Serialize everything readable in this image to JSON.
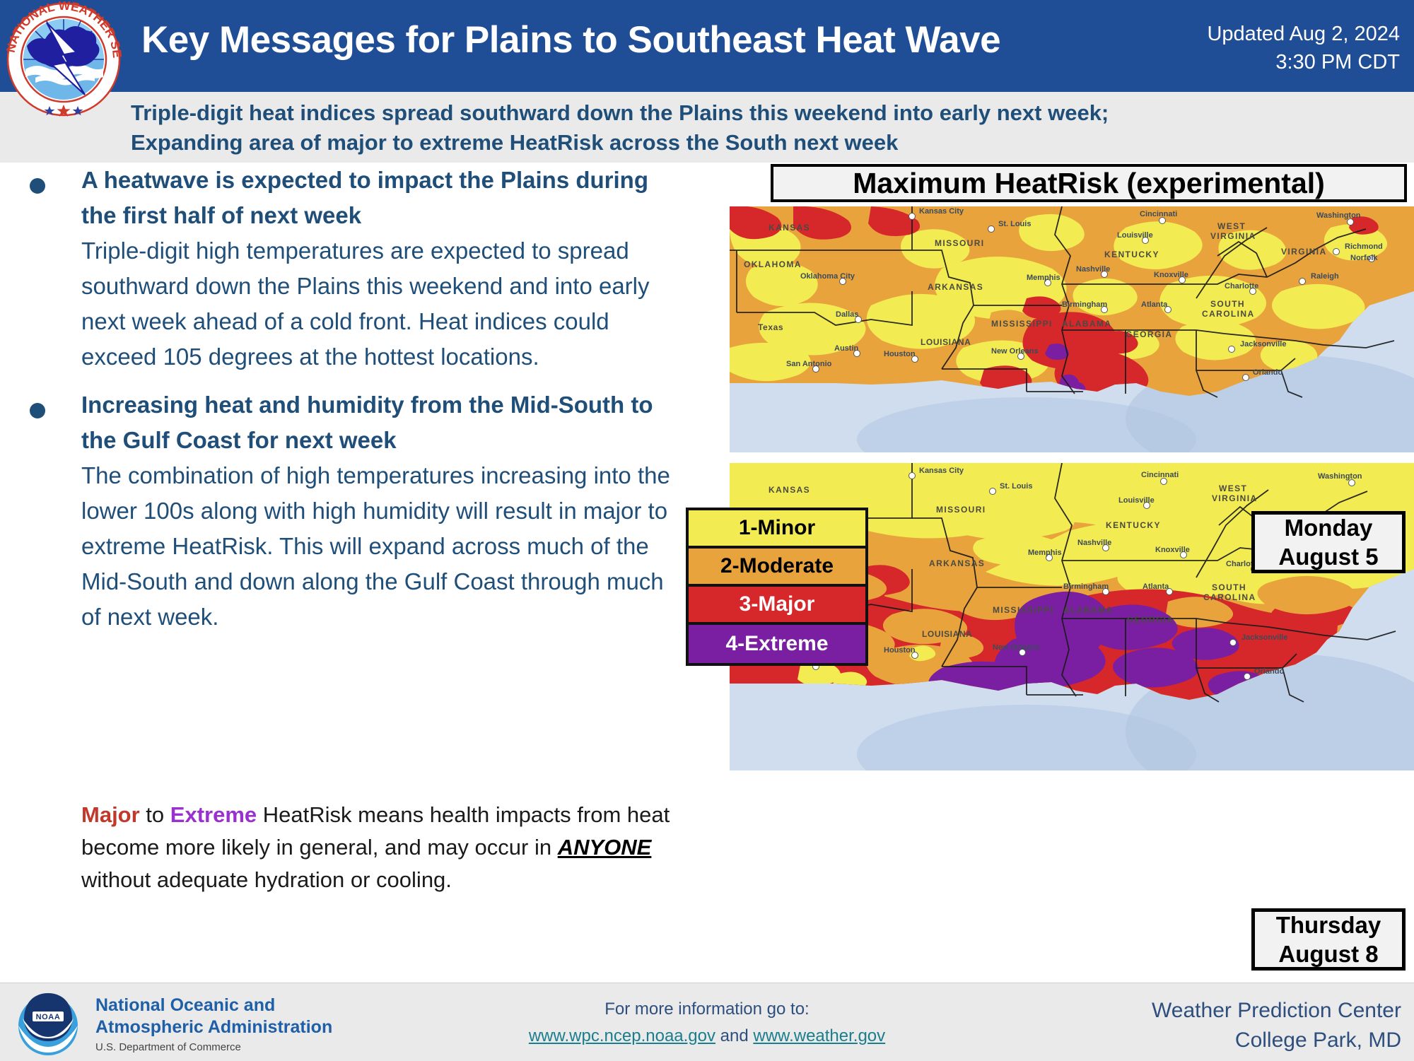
{
  "header": {
    "title": "Key Messages for Plains to Southeast Heat Wave",
    "updated_line1": "Updated Aug 2, 2024",
    "updated_line2": "3:30 PM CDT",
    "logo_alt": "nws-logo",
    "background_color": "#1F4E96"
  },
  "subtitle": {
    "line1": "Triple-digit heat indices spread southward down the Plains this weekend into early next week;",
    "line2": "Expanding area of major to extreme HeatRisk across the South next week",
    "text_color": "#1F4E79",
    "background_color": "#EAEAEA"
  },
  "bullets": [
    {
      "heading": "A heatwave is expected to impact the Plains during the first half of next week",
      "body": "Triple-digit high temperatures are expected to spread southward down the Plains this weekend and into early next week ahead of a cold front.  Heat indices could exceed 105 degrees at the hottest locations."
    },
    {
      "heading": "Increasing heat and humidity from the Mid-South to the Gulf Coast for next week",
      "body": "The combination of high temperatures increasing into the lower 100s along with high humidity will result in major to extreme HeatRisk.  This will expand across much of the Mid-South and down along the Gulf Coast through much of next week."
    }
  ],
  "closing": {
    "word_major": "Major",
    "mid1": " to ",
    "word_extreme": "Extreme",
    "mid2": " HeatRisk means health impacts from heat become more likely in general, and may occur in ",
    "word_anyone": "ANYONE",
    "tail": " without adequate hydration or cooling.",
    "major_color": "#C0392B",
    "extreme_color": "#9B30D0"
  },
  "maps": {
    "title": "Maximum HeatRisk (experimental)",
    "panels": [
      {
        "id": "map-monday",
        "day_line1": "Monday",
        "day_line2": "August 5"
      },
      {
        "id": "map-thursday",
        "day_line1": "Thursday",
        "day_line2": "August 8"
      }
    ],
    "legend": [
      {
        "label": "1-Minor",
        "color": "#F3EB52",
        "text_color": "#000000"
      },
      {
        "label": "2-Moderate",
        "color": "#E8A33D",
        "text_color": "#000000"
      },
      {
        "label": "3-Major",
        "color": "#D6272B",
        "text_color": "#FFFFFF"
      },
      {
        "label": "4-Extreme",
        "color": "#7B1FA2",
        "text_color": "#FFFFFF"
      }
    ],
    "state_labels": [
      "KANSAS",
      "MISSOURI",
      "OKLAHOMA",
      "ARKANSAS",
      "Texas",
      "LOUISIANA",
      "MISSISSIPPI",
      "ALABAMA",
      "GEORGIA",
      "KENTUCKY",
      "WEST VIRGINIA",
      "VIRGINIA",
      "SOUTH CAROLINA"
    ],
    "city_labels": [
      "Kansas City",
      "St. Louis",
      "Cincinnati",
      "Washington",
      "Louisville",
      "Richmond",
      "Norfolk",
      "Nashville",
      "Knoxville",
      "Raleigh",
      "Oklahoma City",
      "Memphis",
      "Charlotte",
      "Dallas",
      "Birmingham",
      "Atlanta",
      "Austin",
      "Houston",
      "San Antonio",
      "New Orleans",
      "Jacksonville",
      "Orlando"
    ],
    "ocean_color": "#BFD3E6"
  },
  "footer": {
    "noaa_line1": "National Oceanic and",
    "noaa_line2": "Atmospheric Administration",
    "noaa_sub": "U.S. Department of Commerce",
    "info_label": "For more information go to:",
    "link1": "www.wpc.ncep.noaa.gov",
    "conjunction": " and ",
    "link2": "www.weather.gov",
    "office_line1": "Weather Prediction Center",
    "office_line2": "College Park, MD"
  }
}
